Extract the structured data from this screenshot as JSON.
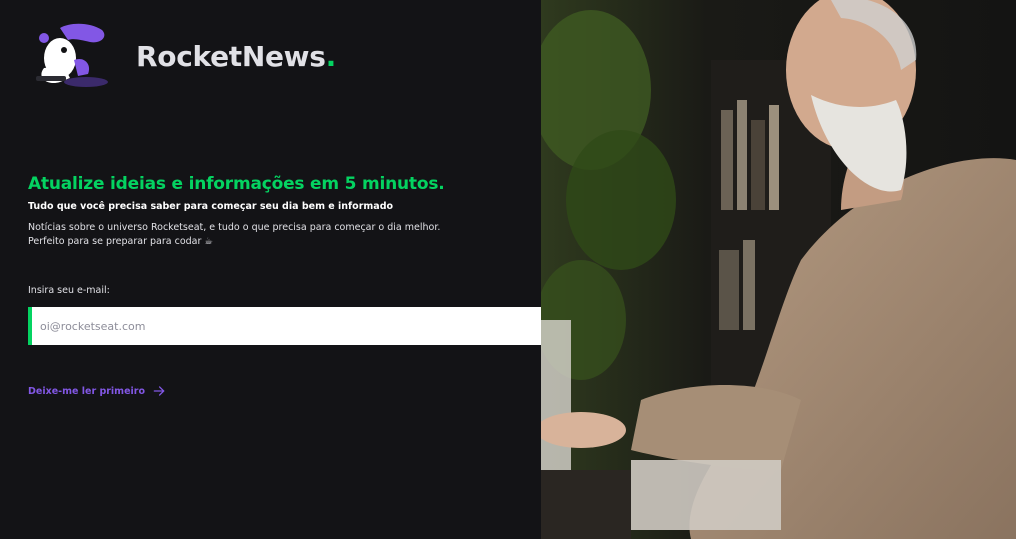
{
  "brand": {
    "name": "RocketNews",
    "dot": "."
  },
  "hero": {
    "headline": "Atualize ideias e informações em 5 minutos.",
    "subheadline": "Tudo que você precisa saber para começar seu dia bem e informado",
    "description_line1": "Notícias sobre o universo Rocketseat, e tudo o que precisa para começar o dia melhor.",
    "description_line2": "Perfeito para se preparar para codar ☕"
  },
  "form": {
    "email_label": "Insira seu e-mail:",
    "email_placeholder": "oi@rocketseat.com",
    "email_value": "",
    "send_icon": "send-icon"
  },
  "cta": {
    "read_first_label": "Deixe-me ler primeiro",
    "icon": "arrow-right-icon"
  },
  "colors": {
    "accent_green": "#04d361",
    "accent_purple": "#8257e5",
    "background": "#121214"
  }
}
